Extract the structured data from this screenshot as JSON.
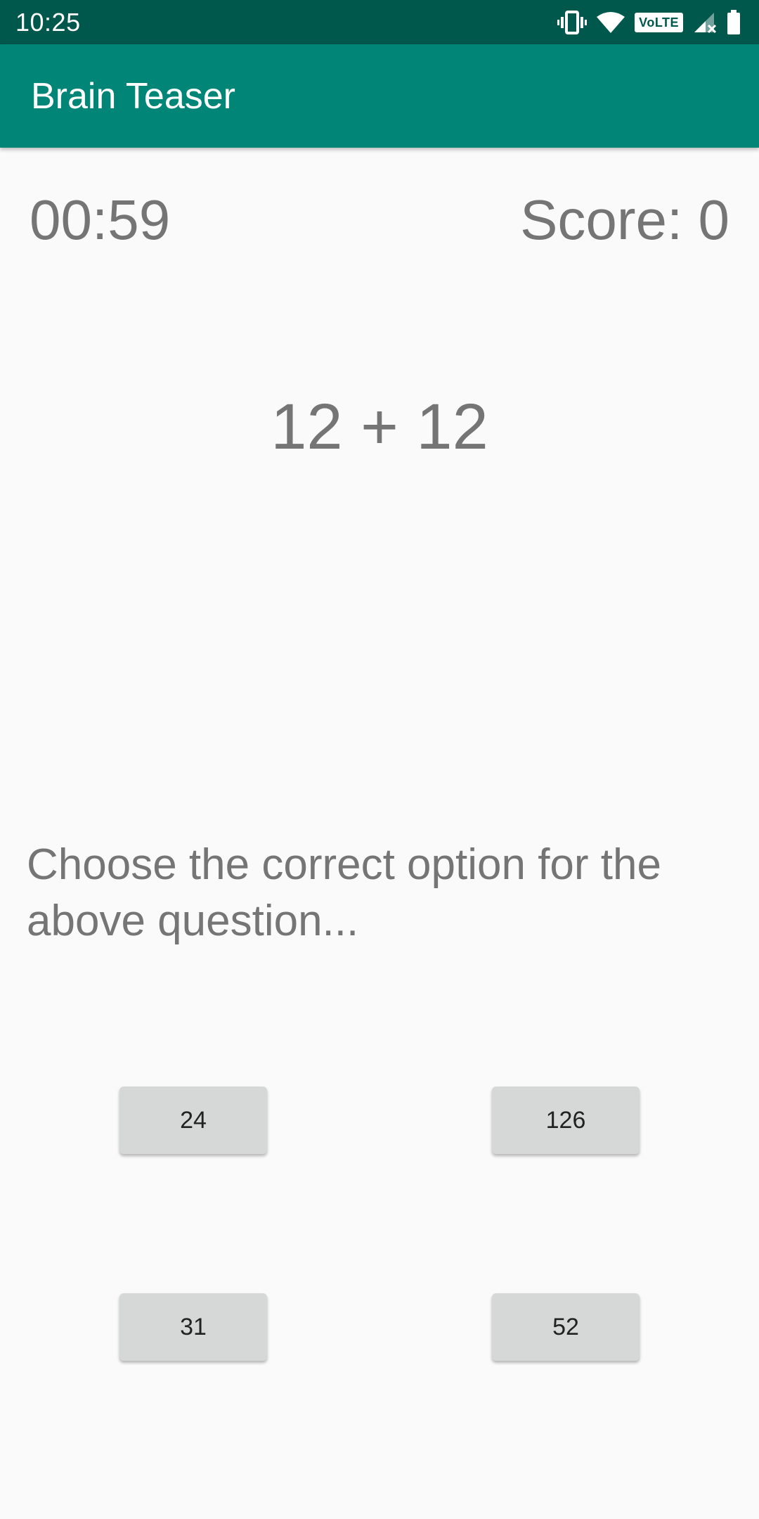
{
  "status_bar": {
    "time": "10:25",
    "icons": [
      "vibrate-icon",
      "wifi-icon",
      "volte-icon",
      "signal-icon",
      "battery-icon"
    ],
    "volte_label": "VoLTE"
  },
  "app_bar": {
    "title": "Brain Teaser",
    "color": "#008577",
    "status_color": "#00574b"
  },
  "game": {
    "timer": "00:59",
    "score": "Score: 0",
    "question": "12 + 12",
    "prompt": "Choose the correct option for the above question...",
    "options": [
      "24",
      "126",
      "31",
      "52"
    ]
  }
}
